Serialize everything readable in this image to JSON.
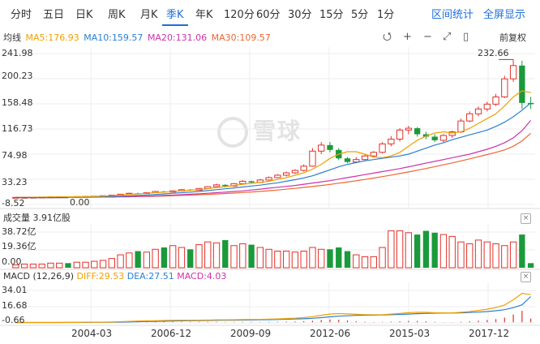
{
  "tabs": [
    "分时",
    "五日",
    "日K",
    "周K",
    "月K",
    "季K",
    "年K",
    "120分",
    "60分",
    "30分",
    "15分",
    "5分",
    "1分"
  ],
  "active_tab": "季K",
  "tools": {
    "interval_stats": "区间统计",
    "fullscreen": "全屏显示"
  },
  "ma": {
    "label": "均线",
    "ma5": "MA5:176.93",
    "ma10": "MA10:159.57",
    "ma20": "MA20:131.06",
    "ma30": "MA30:109.57"
  },
  "colors": {
    "up": "#e0322a",
    "down": "#1a9a3a",
    "ma5": "#f0a000",
    "ma10": "#2a7fd4",
    "ma20": "#cc33aa",
    "ma30": "#ee6633",
    "active": "#1e6fd9"
  },
  "controls": {
    "reset_icon": "⭯",
    "zoom_in_icon": "+",
    "zoom_out_icon": "−",
    "expand_icon": "⤢",
    "tag_icon": "▯",
    "adjust_label": "前复权"
  },
  "price_axis": [
    "241.98",
    "200.23",
    "158.48",
    "116.73",
    "74.98",
    "33.23",
    "-8.52"
  ],
  "max_marker": "232.66",
  "min_marker": "0.00",
  "volume": {
    "title": "成交量 3.91亿股",
    "axis": [
      "38.72亿",
      "19.36亿",
      "0.00"
    ]
  },
  "macd": {
    "title": "MACD (12,26,9)",
    "diff": "DIFF:29.53",
    "dea": "DEA:27.51",
    "macd": "MACD:4.03",
    "axis": [
      "34.01",
      "16.68",
      "-0.66"
    ]
  },
  "dates": [
    "2004-03",
    "2006-12",
    "2009-09",
    "2012-06",
    "2015-03",
    "2017-12"
  ],
  "watermark": "雪球",
  "chart_data": {
    "type": "candlestick",
    "candles": [
      [
        3,
        3.2,
        2.6,
        3.4
      ],
      [
        3.2,
        3.3,
        3,
        3.6
      ],
      [
        3.3,
        3.5,
        3.1,
        3.8
      ],
      [
        3.5,
        3.8,
        3.3,
        4
      ],
      [
        3.8,
        4,
        3.6,
        4.3
      ],
      [
        4,
        4.2,
        3.8,
        4.5
      ],
      [
        4.2,
        4.1,
        3.9,
        4.6
      ],
      [
        4.1,
        4.5,
        3.9,
        4.8
      ],
      [
        4.5,
        4.8,
        4.3,
        5.2
      ],
      [
        4.8,
        5.2,
        4.6,
        5.6
      ],
      [
        5.2,
        6,
        5,
        6.5
      ],
      [
        6,
        7,
        5.8,
        7.5
      ],
      [
        7,
        8.5,
        6.8,
        9
      ],
      [
        8.5,
        10,
        8.2,
        11
      ],
      [
        10,
        9.5,
        8.8,
        11
      ],
      [
        9.5,
        11,
        9,
        12
      ],
      [
        11,
        13,
        10.5,
        14
      ],
      [
        13,
        12,
        11,
        14
      ],
      [
        12,
        14,
        11.5,
        15
      ],
      [
        14,
        16,
        13.5,
        17
      ],
      [
        16,
        15,
        14,
        17
      ],
      [
        15,
        18,
        14.5,
        19
      ],
      [
        18,
        21,
        17,
        22
      ],
      [
        21,
        24,
        20,
        26
      ],
      [
        24,
        22,
        20,
        25
      ],
      [
        22,
        26,
        21,
        27
      ],
      [
        26,
        30,
        25,
        32
      ],
      [
        30,
        28,
        26,
        31
      ],
      [
        28,
        32,
        27,
        34
      ],
      [
        32,
        36,
        31,
        38
      ],
      [
        36,
        40,
        35,
        42
      ],
      [
        40,
        44,
        38,
        46
      ],
      [
        44,
        48,
        42,
        50
      ],
      [
        48,
        55,
        46,
        58
      ],
      [
        55,
        80,
        54,
        85
      ],
      [
        80,
        90,
        75,
        95
      ],
      [
        90,
        82,
        78,
        95
      ],
      [
        82,
        68,
        65,
        85
      ],
      [
        68,
        62,
        60,
        70
      ],
      [
        62,
        66,
        60,
        70
      ],
      [
        66,
        72,
        64,
        74
      ],
      [
        72,
        78,
        70,
        80
      ],
      [
        78,
        92,
        76,
        95
      ],
      [
        92,
        100,
        88,
        105
      ],
      [
        100,
        115,
        96,
        118
      ],
      [
        115,
        118,
        108,
        122
      ],
      [
        118,
        108,
        104,
        120
      ],
      [
        108,
        104,
        100,
        112
      ],
      [
        104,
        98,
        95,
        108
      ],
      [
        98,
        106,
        95,
        108
      ],
      [
        106,
        112,
        102,
        114
      ],
      [
        112,
        130,
        110,
        134
      ],
      [
        130,
        142,
        128,
        146
      ],
      [
        142,
        150,
        138,
        154
      ],
      [
        150,
        158,
        146,
        162
      ],
      [
        158,
        170,
        155,
        175
      ],
      [
        170,
        200,
        168,
        205
      ],
      [
        200,
        222,
        195,
        232
      ],
      [
        222,
        160,
        150,
        230
      ],
      [
        160,
        158,
        150,
        170
      ]
    ],
    "ma5": [
      3,
      3.1,
      3.3,
      3.5,
      3.7,
      4,
      4.1,
      4.3,
      4.5,
      4.8,
      5.3,
      6,
      7,
      8.3,
      9,
      10,
      11,
      12,
      12.8,
      14,
      15,
      16,
      17.5,
      19.5,
      21,
      23,
      25,
      26.5,
      28,
      30,
      33,
      36,
      40,
      44,
      50,
      58,
      68,
      75,
      79,
      79,
      75,
      70,
      69,
      72,
      78,
      88,
      98,
      105,
      110,
      112,
      110,
      112,
      118,
      126,
      134,
      142,
      155,
      170,
      180,
      177
    ],
    "ma10": [
      3,
      3.1,
      3.2,
      3.3,
      3.5,
      3.6,
      3.8,
      4,
      4.1,
      4.3,
      4.5,
      4.8,
      5.2,
      5.8,
      6.5,
      7.2,
      8,
      9,
      10,
      11,
      12,
      13,
      14.5,
      16,
      17.5,
      19,
      20.5,
      22,
      23.5,
      25.5,
      27.5,
      30,
      32.5,
      35.5,
      39,
      44,
      49,
      54,
      58,
      61,
      64,
      66,
      68,
      70,
      72,
      75,
      80,
      85,
      90,
      94,
      99,
      103,
      107,
      111,
      115,
      121,
      128,
      137,
      148,
      160
    ],
    "ma20": [
      3,
      3,
      3.1,
      3.2,
      3.3,
      3.4,
      3.5,
      3.6,
      3.7,
      3.9,
      4,
      4.2,
      4.4,
      4.7,
      5,
      5.4,
      5.9,
      6.4,
      7,
      7.7,
      8.4,
      9.2,
      10,
      11,
      12,
      13,
      14,
      15.5,
      17,
      18.5,
      20,
      21.5,
      23,
      25,
      27,
      29,
      31,
      33.5,
      36,
      38.5,
      41,
      43.5,
      46,
      48.5,
      51,
      54,
      57,
      60,
      63,
      66,
      69,
      72,
      75,
      79,
      83,
      88,
      94,
      102,
      114,
      131
    ],
    "ma30": [
      3,
      3,
      3,
      3.1,
      3.1,
      3.2,
      3.3,
      3.4,
      3.5,
      3.6,
      3.7,
      3.8,
      4,
      4.2,
      4.5,
      4.8,
      5.1,
      5.5,
      6,
      6.5,
      7,
      7.6,
      8.2,
      8.9,
      9.6,
      10.4,
      11.3,
      12.2,
      13.2,
      14.3,
      15.5,
      16.8,
      18.2,
      19.7,
      21.3,
      23,
      24.8,
      26.7,
      28.7,
      30.8,
      33,
      35.3,
      37.7,
      40.2,
      42.8,
      45.5,
      48.3,
      51.2,
      54.2,
      57.3,
      60.5,
      63.8,
      67.2,
      70.7,
      74.3,
      78,
      82,
      88,
      97,
      109.57
    ],
    "volume": [
      3,
      4,
      4,
      4,
      5,
      5,
      5,
      6,
      6,
      7,
      8,
      10,
      14,
      16,
      18,
      17,
      20,
      22,
      24,
      22,
      20,
      25,
      28,
      27,
      30,
      24,
      26,
      25,
      22,
      20,
      18,
      18,
      17,
      18,
      22,
      20,
      20,
      22,
      18,
      14,
      12,
      12,
      22,
      40,
      40,
      38,
      36,
      40,
      38,
      36,
      34,
      28,
      26,
      30,
      28,
      26,
      24,
      28,
      36,
      5
    ],
    "diff": [
      -0.3,
      -0.3,
      -0.2,
      -0.2,
      -0.2,
      -0.1,
      -0.1,
      -0.1,
      0,
      0,
      0.1,
      0.3,
      0.6,
      1,
      1.3,
      1.5,
      1.7,
      1.9,
      2.1,
      2.2,
      2.2,
      2.3,
      2.4,
      2.6,
      2.6,
      2.7,
      2.9,
      3,
      3.1,
      3.3,
      3.6,
      4,
      4.4,
      5,
      6,
      7.5,
      8.8,
      9.3,
      9,
      8.5,
      8.2,
      8,
      8.2,
      8.8,
      9.5,
      10.3,
      10.7,
      10.6,
      10.2,
      10,
      10.1,
      10.7,
      11.5,
      12.7,
      14,
      15.7,
      18.5,
      24,
      31,
      29.53
    ],
    "dea": [
      -0.2,
      -0.2,
      -0.2,
      -0.2,
      -0.2,
      -0.2,
      -0.1,
      -0.1,
      -0.1,
      0,
      0,
      0.1,
      0.2,
      0.4,
      0.6,
      0.8,
      1,
      1.2,
      1.4,
      1.6,
      1.7,
      1.8,
      1.9,
      2.1,
      2.2,
      2.3,
      2.4,
      2.5,
      2.7,
      2.8,
      3,
      3.2,
      3.5,
      3.8,
      4.3,
      5,
      5.8,
      6.5,
      7,
      7.4,
      7.6,
      7.7,
      7.8,
      8.1,
      8.4,
      8.8,
      9.2,
      9.5,
      9.7,
      9.8,
      9.9,
      10.1,
      10.4,
      10.9,
      11.5,
      12.3,
      13.5,
      15.6,
      18.7,
      27.51
    ],
    "macd_hist": [
      -0.1,
      -0.1,
      0,
      0,
      0,
      0.1,
      0,
      0,
      0.1,
      0,
      0.1,
      0.2,
      0.4,
      0.6,
      0.7,
      0.7,
      0.7,
      0.7,
      0.7,
      0.6,
      0.5,
      0.5,
      0.5,
      0.5,
      0.4,
      0.4,
      0.5,
      0.5,
      0.4,
      0.5,
      0.6,
      0.8,
      0.9,
      1.2,
      1.7,
      2.5,
      3,
      2.8,
      2,
      1.1,
      0.6,
      0.3,
      0.4,
      0.7,
      1.1,
      1.5,
      1.5,
      1.1,
      0.5,
      0.2,
      0.2,
      0.6,
      1.1,
      1.8,
      2.5,
      3.4,
      5,
      8.4,
      12.3,
      4.03
    ],
    "ylim": [
      -8.52,
      241.98
    ],
    "volume_ylim": [
      0,
      38.72
    ],
    "macd_ylim": [
      -0.66,
      34.01
    ]
  }
}
